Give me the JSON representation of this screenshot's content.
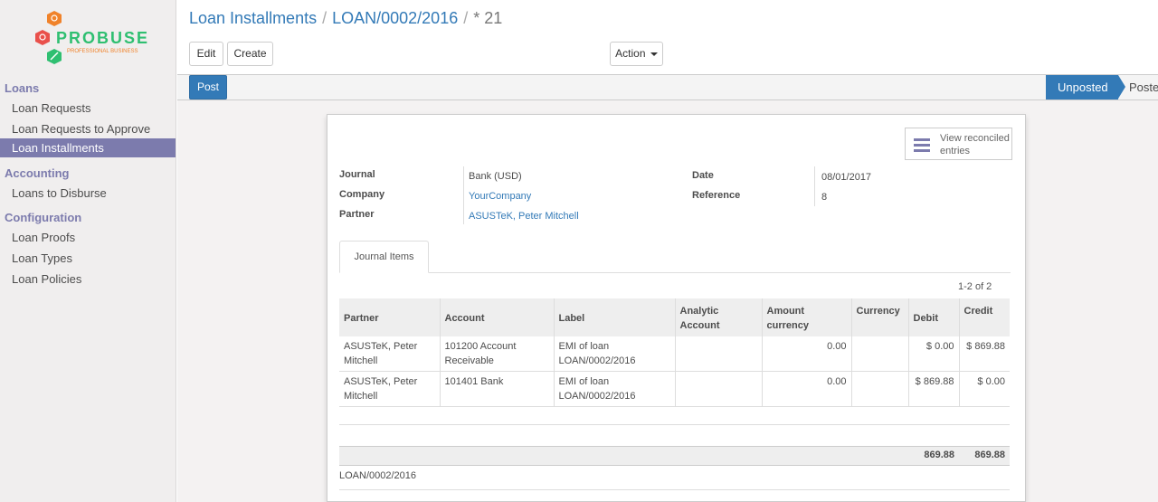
{
  "brand": {
    "name": "PROBUSE",
    "tagline": "PROFESSIONAL BUSINESS"
  },
  "sidebar": {
    "sections": [
      {
        "title": "Loans",
        "items": [
          "Loan Requests",
          "Loan Requests to Approve",
          "Loan Installments"
        ]
      },
      {
        "title": "Accounting",
        "items": [
          "Loans to Disburse"
        ]
      },
      {
        "title": "Configuration",
        "items": [
          "Loan Proofs",
          "Loan Types",
          "Loan Policies"
        ]
      }
    ],
    "active_item": "Loan Installments"
  },
  "breadcrumb": {
    "root": "Loan Installments",
    "loan": "LOAN/0002/2016",
    "current": "* 21"
  },
  "toolbar": {
    "edit": "Edit",
    "create": "Create",
    "action": "Action"
  },
  "statusbar": {
    "post": "Post",
    "stage_current": "Unposted",
    "stage_next": "Posted"
  },
  "smart_button": {
    "line1": "View reconciled",
    "line2": "entries"
  },
  "form": {
    "journal_label": "Journal",
    "journal": "Bank (USD)",
    "company_label": "Company",
    "company": "YourCompany",
    "partner_label": "Partner",
    "partner": "ASUSTeK, Peter Mitchell",
    "date_label": "Date",
    "date": "08/01/2017",
    "reference_label": "Reference",
    "reference": "8"
  },
  "tab": {
    "label": "Journal Items"
  },
  "pager": "1-2 of 2",
  "table": {
    "headers": {
      "partner": "Partner",
      "account": "Account",
      "label": "Label",
      "analytic1": "Analytic",
      "analytic2": "Account",
      "amount1": "Amount",
      "amount2": "currency",
      "currency": "Currency",
      "debit": "Debit",
      "credit": "Credit"
    },
    "rows": [
      {
        "partner1": "ASUSTeK, Peter",
        "partner2": "Mitchell",
        "account1": "101200 Account",
        "account2": "Receivable",
        "label1": "EMI of loan",
        "label2": "LOAN/0002/2016",
        "analytic": "",
        "amount": "0.00",
        "currency": "",
        "debit": "$ 0.00",
        "credit": "$ 869.88"
      },
      {
        "partner1": "ASUSTeK, Peter",
        "partner2": "Mitchell",
        "account1": "101401 Bank",
        "account2": "",
        "label1": "EMI of loan",
        "label2": "LOAN/0002/2016",
        "analytic": "",
        "amount": "0.00",
        "currency": "",
        "debit": "$ 869.88",
        "credit": "$ 0.00"
      }
    ],
    "totals": {
      "debit": "869.88",
      "credit": "869.88"
    }
  },
  "narration": "LOAN/0002/2016",
  "colors": {
    "primary": "#337ab7",
    "menu_accent": "#7c7bad",
    "logo_orange": "#f0822a",
    "logo_red": "#e9504b",
    "logo_green": "#2fbf71"
  }
}
